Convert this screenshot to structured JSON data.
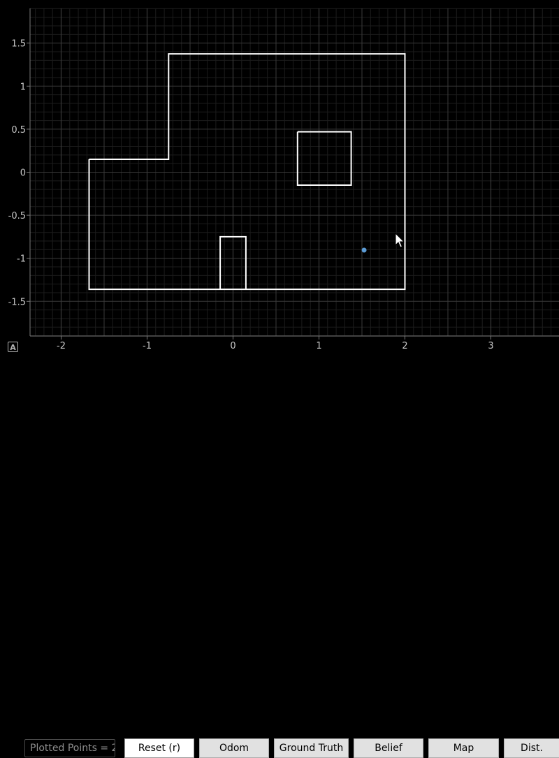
{
  "plot": {
    "x_ticks": [
      "-2",
      "-1",
      "0",
      "1",
      "2",
      "3"
    ],
    "y_ticks": [
      "1.5",
      "1",
      "0.5",
      "0",
      "-0.5",
      "-1",
      "-1.5"
    ],
    "xlim": [
      -2.35,
      3.8
    ],
    "ylim": [
      -1.9,
      1.9
    ],
    "map_walls": [
      [
        [
          -1.675,
          0.15
        ],
        [
          -0.75,
          0.15
        ],
        [
          -0.75,
          1.375
        ],
        [
          2.0,
          1.375
        ],
        [
          2.0,
          -1.36
        ],
        [
          -1.675,
          -1.36
        ],
        [
          -1.675,
          0.15
        ]
      ],
      [
        [
          0.75,
          0.47
        ],
        [
          1.375,
          0.47
        ],
        [
          1.375,
          -0.15
        ],
        [
          0.75,
          -0.15
        ],
        [
          0.75,
          0.47
        ]
      ],
      [
        [
          -0.15,
          -1.36
        ],
        [
          -0.15,
          -0.75
        ],
        [
          0.15,
          -0.75
        ],
        [
          0.15,
          -1.36
        ]
      ]
    ],
    "points": [
      {
        "x": 1.525,
        "y": -0.905,
        "color": "#5b9bd5"
      }
    ],
    "autoscale_glyph": "A",
    "colors": {
      "background": "#000000",
      "grid_major": "#3a3a3a",
      "grid_minor": "#1c1c1c",
      "axis_frame": "#7a7a7a",
      "walls": "#ffffff"
    }
  },
  "toolbar": {
    "plotted_points_text": "Plotted Points = 2",
    "reset_label": "Reset (r)",
    "odom_label": "Odom",
    "ground_truth_label": "Ground Truth",
    "belief_label": "Belief",
    "map_label": "Map",
    "dist_label": "Dist."
  }
}
